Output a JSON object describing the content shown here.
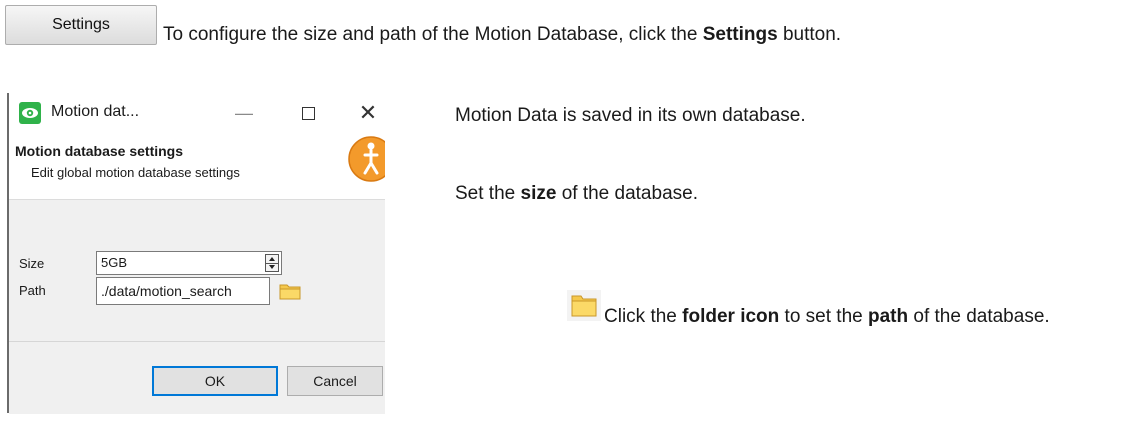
{
  "settings_button": {
    "label": "Settings"
  },
  "intro": {
    "before": "To configure the size and path of the Motion Database, click the ",
    "bold": "Settings",
    "after": " button."
  },
  "dialog": {
    "title": "Motion dat...",
    "heading": "Motion database settings",
    "subheading": "Edit global motion database settings",
    "size_label": "Size",
    "size_value": "5GB",
    "path_label": "Path",
    "path_value": "./data/motion_search",
    "ok_label": "OK",
    "cancel_label": "Cancel",
    "min_symbol": "—",
    "close_symbol": "✕"
  },
  "notes": {
    "saved": "Motion Data is saved in its own database.",
    "size_before": "Set the ",
    "size_bold": "size",
    "size_after": " of the database.",
    "folder_before": "Click the ",
    "folder_bold": "folder icon",
    "folder_mid": " to set the ",
    "folder_bold2": "path",
    "folder_after": " of the database."
  },
  "icons": {
    "app": "motion-eye-icon",
    "badge": "motion-person-icon",
    "folder": "folder-icon"
  },
  "colors": {
    "accent": "#0078d7",
    "folder": "#f5c84c",
    "badge": "#f39a2b",
    "app_icon": "#2fb24a"
  }
}
